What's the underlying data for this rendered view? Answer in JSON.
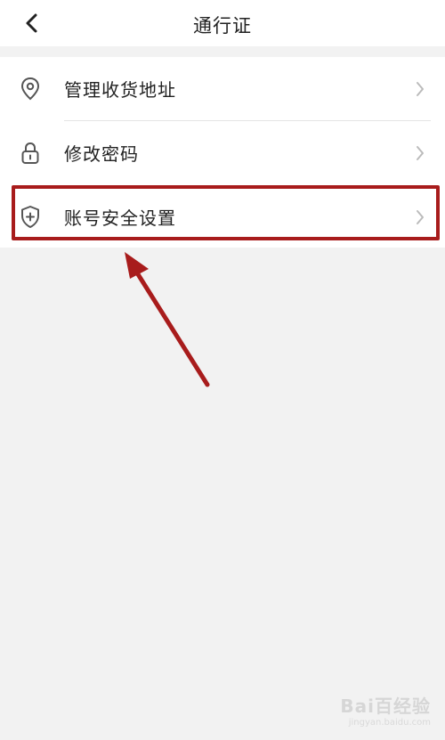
{
  "header": {
    "title": "通行证",
    "back_icon": "chevron-left-icon"
  },
  "menu": {
    "items": [
      {
        "label": "管理收货地址",
        "icon": "location-pin-icon"
      },
      {
        "label": "修改密码",
        "icon": "lock-icon"
      },
      {
        "label": "账号安全设置",
        "icon": "shield-plus-icon"
      }
    ]
  },
  "annotation": {
    "highlight_color": "#a81c1c",
    "arrow_color": "#a81c1c"
  },
  "watermark": {
    "brand": "Bai百经验",
    "url": "jingyan.baidu.com"
  },
  "colors": {
    "background": "#f2f2f2",
    "surface": "#ffffff",
    "text": "#222222",
    "icon": "#555555",
    "chevron": "#bbbbbb"
  }
}
